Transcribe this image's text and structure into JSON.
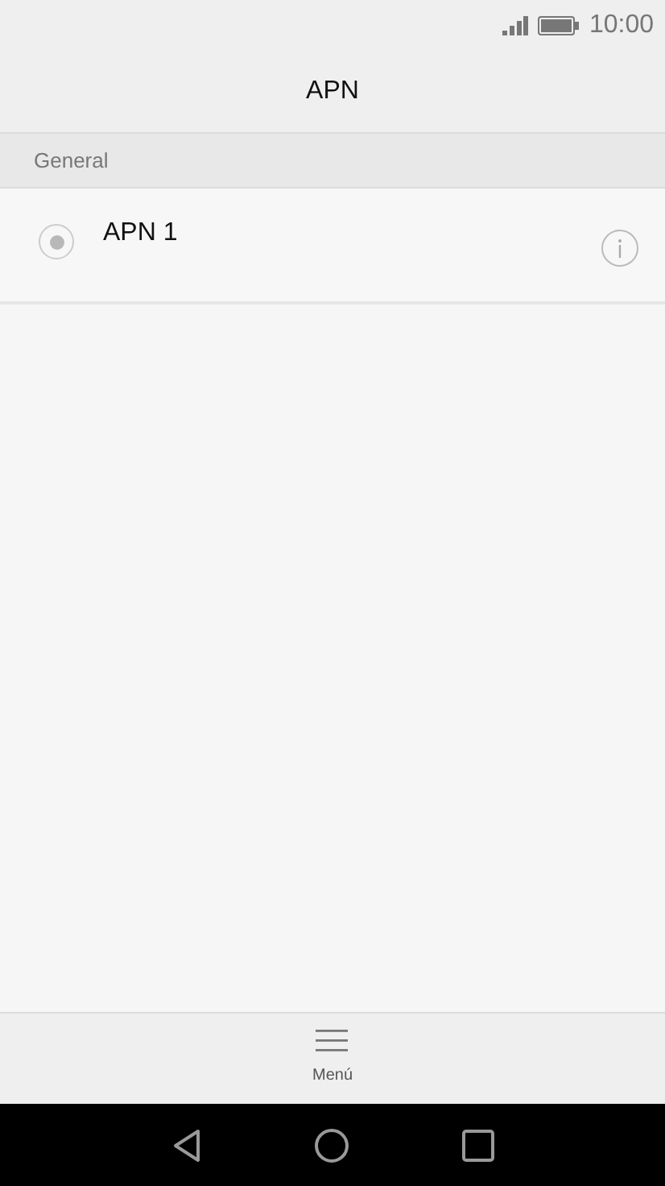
{
  "status_bar": {
    "time": "10:00"
  },
  "title": "APN",
  "section": {
    "title": "General",
    "items": [
      {
        "label": "APN 1",
        "selected": true
      }
    ]
  },
  "bottom_bar": {
    "menu_label": "Menú"
  }
}
